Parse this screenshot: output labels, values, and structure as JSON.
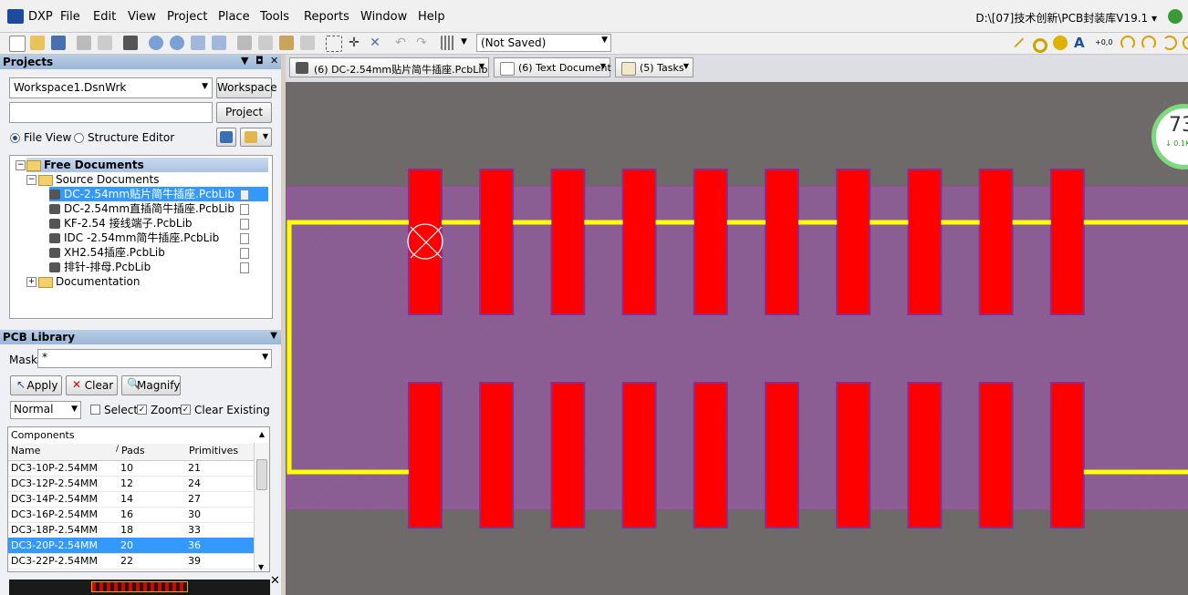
{
  "menubar": {
    "items": [
      "DXP",
      "File",
      "Edit",
      "View",
      "Project",
      "Place",
      "Tools",
      "Reports",
      "Window",
      "Help"
    ],
    "path_title": "D:\\[07]技术创新\\PCB封装库V19.1 ▾"
  },
  "toolbar": {
    "save_status": "(Not Saved)"
  },
  "projects_panel": {
    "title": "Projects",
    "workspace_value": "Workspace1.DsnWrk",
    "workspace_button": "Workspace",
    "project_button": "Project",
    "file_view": "File View",
    "structure_editor": "Structure Editor",
    "tree": {
      "root": "Free Documents",
      "source": "Source Documents",
      "files": [
        "DC-2.54mm贴片简牛插座.PcbLib",
        "DC-2.54mm直插简牛插座.PcbLib",
        "KF-2.54 接线端子.PcbLib",
        "IDC -2.54mm简牛插座.PcbLib",
        "XH2.54插座.PcbLib",
        "排针-排母.PcbLib"
      ],
      "documentation": "Documentation"
    }
  },
  "pcb_library": {
    "title": "PCB Library",
    "mask_label": "Mask",
    "mask_value": "*",
    "apply": "Apply",
    "clear": "Clear",
    "magnify": "Magnify",
    "mode": "Normal",
    "select": "Select",
    "zoom": "Zoom",
    "clear_existing": "Clear Existing",
    "components_label": "Components",
    "columns": [
      "Name",
      "Pads",
      "Primitives"
    ],
    "rows": [
      [
        "DC3-10P-2.54MM",
        "10",
        "21"
      ],
      [
        "DC3-12P-2.54MM",
        "12",
        "24"
      ],
      [
        "DC3-14P-2.54MM",
        "14",
        "27"
      ],
      [
        "DC3-16P-2.54MM",
        "16",
        "30"
      ],
      [
        "DC3-18P-2.54MM",
        "18",
        "33"
      ],
      [
        "DC3-20P-2.54MM",
        "20",
        "36"
      ],
      [
        "DC3-22P-2.54MM",
        "22",
        "39"
      ]
    ],
    "selected_row": 5
  },
  "doc_tabs": [
    {
      "label": "(6) DC-2.54mm贴片简牛插座.PcbLib",
      "icon": "pcb-lib-icon"
    },
    {
      "label": "(6) Text Document",
      "icon": "text-doc-icon"
    },
    {
      "label": "(5) Tasks",
      "icon": "tasks-icon"
    }
  ],
  "canvas": {
    "pads_per_row": 10,
    "pad_color": "#ff0000",
    "overlay_color": "#ffff00",
    "board_color": "#6e6a6a",
    "perf_value": "73",
    "perf_sub": "↓ 0.1K"
  }
}
